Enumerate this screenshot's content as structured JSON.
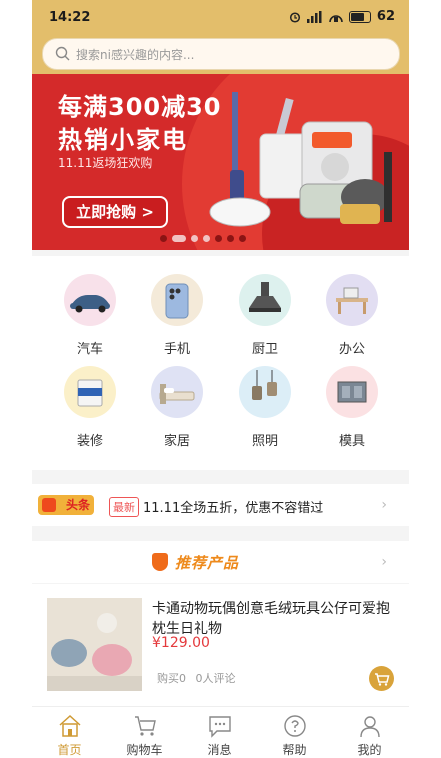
{
  "status_bar": {
    "time": "14:22",
    "battery": "62"
  },
  "search": {
    "placeholder": "搜索ni感兴趣的内容..."
  },
  "banner": {
    "title_line1": "每满300减30",
    "title_line2": "热销小家电",
    "subtitle": "11.11返场狂欢购",
    "button_label": "立即抢购 >",
    "slide_count": 7,
    "active_slide": 2
  },
  "categories": [
    {
      "label": "汽车",
      "icon": "car-icon",
      "color": "#f8e1ea"
    },
    {
      "label": "手机",
      "icon": "phone-icon",
      "color": "#f4ead9"
    },
    {
      "label": "厨卫",
      "icon": "range-hood-icon",
      "color": "#ddf1ee"
    },
    {
      "label": "办公",
      "icon": "office-icon",
      "color": "#e2def2"
    },
    {
      "label": "装修",
      "icon": "paint-bucket-icon",
      "color": "#fbf0c9"
    },
    {
      "label": "家居",
      "icon": "bed-icon",
      "color": "#dfe2f4"
    },
    {
      "label": "照明",
      "icon": "lamp-icon",
      "color": "#dceef7"
    },
    {
      "label": "模具",
      "icon": "mold-icon",
      "color": "#fbe1e3"
    }
  ],
  "notice": {
    "hot_label": "头条",
    "new_tag": "最新",
    "text": "11.11全场五折，优惠不容错过"
  },
  "recommend": {
    "title": "推荐产品"
  },
  "product": {
    "name": "卡通动物玩偶创意毛绒玩具公仔可爱抱枕生日礼物",
    "price": "¥129.00",
    "buy_count": "购买0",
    "review_count": "0人评论"
  },
  "tabs": [
    {
      "label": "首页",
      "icon": "home-icon",
      "active": true
    },
    {
      "label": "购物车",
      "icon": "cart-icon",
      "active": false
    },
    {
      "label": "消息",
      "icon": "message-icon",
      "active": false
    },
    {
      "label": "帮助",
      "icon": "help-icon",
      "active": false
    },
    {
      "label": "我的",
      "icon": "user-icon",
      "active": false
    }
  ],
  "colors": {
    "accent": "#e3be6b",
    "banner_red": "#d42a2a",
    "price_red": "#e4393c",
    "tab_active": "#cf9a34"
  }
}
